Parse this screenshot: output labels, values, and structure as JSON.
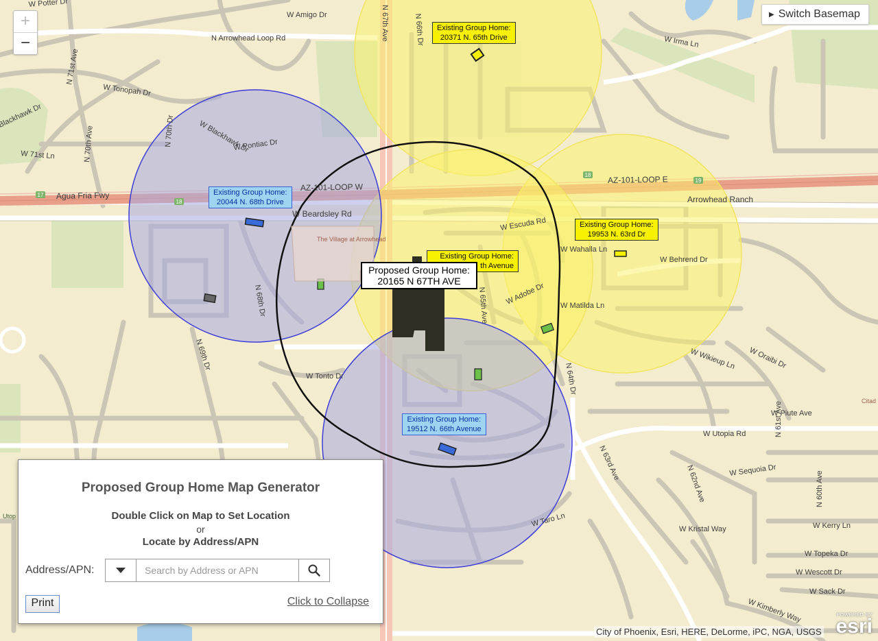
{
  "map": {
    "zoom_in": "+",
    "zoom_out": "−",
    "switch_basemap": "Switch Basemap",
    "attribution": "City of Phoenix, Esri, HERE, DeLorme, iPC, NGA, USGS",
    "esri_powered": "POWERED BY",
    "esri_name": "esri",
    "colors": {
      "base": "#f3eccf",
      "park": "#d7e4b8",
      "road_line": "#cbc5b5",
      "highway": "#e8a08a",
      "yellow_buffer": "#fbf26a",
      "blue_buffer": "#b8b9e6",
      "proposed_ring": "#111111",
      "water": "#a9cde9"
    },
    "street_labels": [
      {
        "t": "W Potter Dr"
      },
      {
        "t": "W Amigo Dr"
      },
      {
        "t": "N Arrowhead Loop Rd"
      },
      {
        "t": "W Irma Ln"
      },
      {
        "t": "N 71st Ave"
      },
      {
        "t": "W Tonopah Dr"
      },
      {
        "t": "Blackhawk Dr"
      },
      {
        "t": "N 70th Ave"
      },
      {
        "t": "N 70th Dr"
      },
      {
        "t": "W Blackhawk Dr"
      },
      {
        "t": "W Pontiac Dr"
      },
      {
        "t": "W 71st Ln"
      },
      {
        "t": "Agua Fria Fwy"
      },
      {
        "t": "AZ-101-LOOP W"
      },
      {
        "t": "AZ-101-LOOP E"
      },
      {
        "t": "W Beardsley Rd"
      },
      {
        "t": "Arrowhead Ranch"
      },
      {
        "t": "W Escuda Rd"
      },
      {
        "t": "W Wahalla Ln"
      },
      {
        "t": "W Behrend Dr"
      },
      {
        "t": "W Adobe Dr"
      },
      {
        "t": "W Matilda Ln"
      },
      {
        "t": "N 64th Dr"
      },
      {
        "t": "W Wikieup Ln"
      },
      {
        "t": "W Oraibi Dr"
      },
      {
        "t": "W Tonto Dr"
      },
      {
        "t": "W Piute Ave"
      },
      {
        "t": "W Utopia Rd"
      },
      {
        "t": "W Kristal Way"
      },
      {
        "t": "W Taro Ln"
      },
      {
        "t": "N 63rd Ave"
      },
      {
        "t": "W Sequoia Dr"
      },
      {
        "t": "N 62nd Ave"
      },
      {
        "t": "W Kerry Ln"
      },
      {
        "t": "W Topeka Dr"
      },
      {
        "t": "W Wescott Dr"
      },
      {
        "t": "W Sack Dr"
      },
      {
        "t": "W Kimberly Way"
      },
      {
        "t": "N 67th Ave"
      },
      {
        "t": "N 68th Dr"
      },
      {
        "t": "N 69th Dr"
      },
      {
        "t": "N 66th Dr"
      },
      {
        "t": "N 65th Ave"
      },
      {
        "t": "N 61st Ave"
      },
      {
        "t": "N 60th Ave"
      },
      {
        "t": "The Village at Arrowhead"
      },
      {
        "t": "Citad Pla"
      },
      {
        "t": "Utop Park"
      }
    ]
  },
  "existing_homes": [
    {
      "line1": "Existing Group Home:",
      "line2": "20371 N. 65th Drive",
      "kind": "yellow"
    },
    {
      "line1": "Existing Group Home:",
      "line2": "20044 N. 68th Drive",
      "kind": "blue"
    },
    {
      "line1": "Existing Group Home:",
      "line2": "19953 N. 63rd Dr",
      "kind": "yellow"
    },
    {
      "line1": "Existing Group Home:",
      "line2": "th Avenue",
      "kind": "yellow"
    },
    {
      "line1": "Existing Group Home:",
      "line2": "19512 N. 66th Avenue",
      "kind": "blue"
    }
  ],
  "proposed_home": {
    "line1": "Proposed Group Home:",
    "line2": "20165 N 67TH AVE"
  },
  "panel": {
    "title": "Proposed Group Home Map Generator",
    "instruction1": "Double Click on Map to Set Location",
    "instruction_or": "or",
    "instruction2": "Locate by Address/APN",
    "address_label": "Address/APN:",
    "search_placeholder": "Search by Address or APN",
    "search_value": "",
    "print_label": "Print",
    "collapse_label": "Click to Collapse"
  }
}
